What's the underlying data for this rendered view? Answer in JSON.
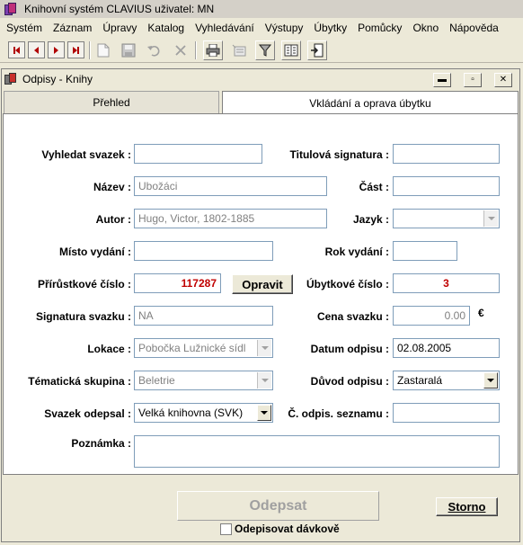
{
  "app": {
    "title": "Knihovní systém CLAVIUS  uživatel: MN"
  },
  "menu": [
    "Systém",
    "Záznam",
    "Úpravy",
    "Katalog",
    "Vyhledávání",
    "Výstupy",
    "Úbytky",
    "Pomůcky",
    "Okno",
    "Nápověda"
  ],
  "toolbar": {
    "icons": [
      "first-record-icon",
      "previous-record-icon",
      "next-record-icon",
      "last-record-icon",
      "new-record-icon",
      "save-icon",
      "undo-icon",
      "delete-icon",
      "print-icon",
      "list-icon",
      "filter-icon",
      "notes-icon",
      "exit-icon"
    ]
  },
  "window": {
    "title": "Odpisy - Knihy",
    "controls": {
      "minimize": "▬",
      "restore": "▫",
      "close": "✕"
    }
  },
  "tabs": [
    {
      "label": "Přehled",
      "active": false
    },
    {
      "label": "Vkládání a oprava úbytku",
      "active": true
    }
  ],
  "form": {
    "search_volume": {
      "label": "Vyhledat svazek :",
      "value": ""
    },
    "title_signature": {
      "label": "Titulová signatura :",
      "value": ""
    },
    "name": {
      "label": "Název :",
      "value": "Ubožáci"
    },
    "part": {
      "label": "Část :",
      "value": ""
    },
    "author": {
      "label": "Autor :",
      "value": "Hugo, Victor, 1802-1885"
    },
    "language": {
      "label": "Jazyk :",
      "value": ""
    },
    "place": {
      "label": "Místo vydání :",
      "value": ""
    },
    "year": {
      "label": "Rok vydání :",
      "value": ""
    },
    "accession": {
      "label": "Přírůstkové číslo :",
      "value": "117287"
    },
    "fix_button": {
      "label": "Opravit"
    },
    "decrement_no": {
      "label": "Úbytkové číslo :",
      "value": "3"
    },
    "volume_signature": {
      "label": "Signatura svazku :",
      "value": "NA"
    },
    "price": {
      "label": "Cena svazku :",
      "value": "0.00",
      "currency": "€"
    },
    "location": {
      "label": "Lokace :",
      "value": "Pobočka Lužnické sídl"
    },
    "writeoff_date": {
      "label": "Datum odpisu :",
      "value": "02.08.2005"
    },
    "topic_group": {
      "label": "Tématická skupina :",
      "value": "Beletrie"
    },
    "reason": {
      "label": "Důvod odpisu :",
      "value": "Zastaralá"
    },
    "written_by": {
      "label": "Svazek odepsal :",
      "value": "Velká knihovna (SVK)"
    },
    "writeoff_list_no": {
      "label": "Č. odpis. seznamu :",
      "value": ""
    },
    "note": {
      "label": "Poznámka :",
      "value": ""
    }
  },
  "actions": {
    "write_off": "Odepsat",
    "cancel": "Storno",
    "batch_label": "Odepisovat dávkově",
    "batch_checked": false
  }
}
